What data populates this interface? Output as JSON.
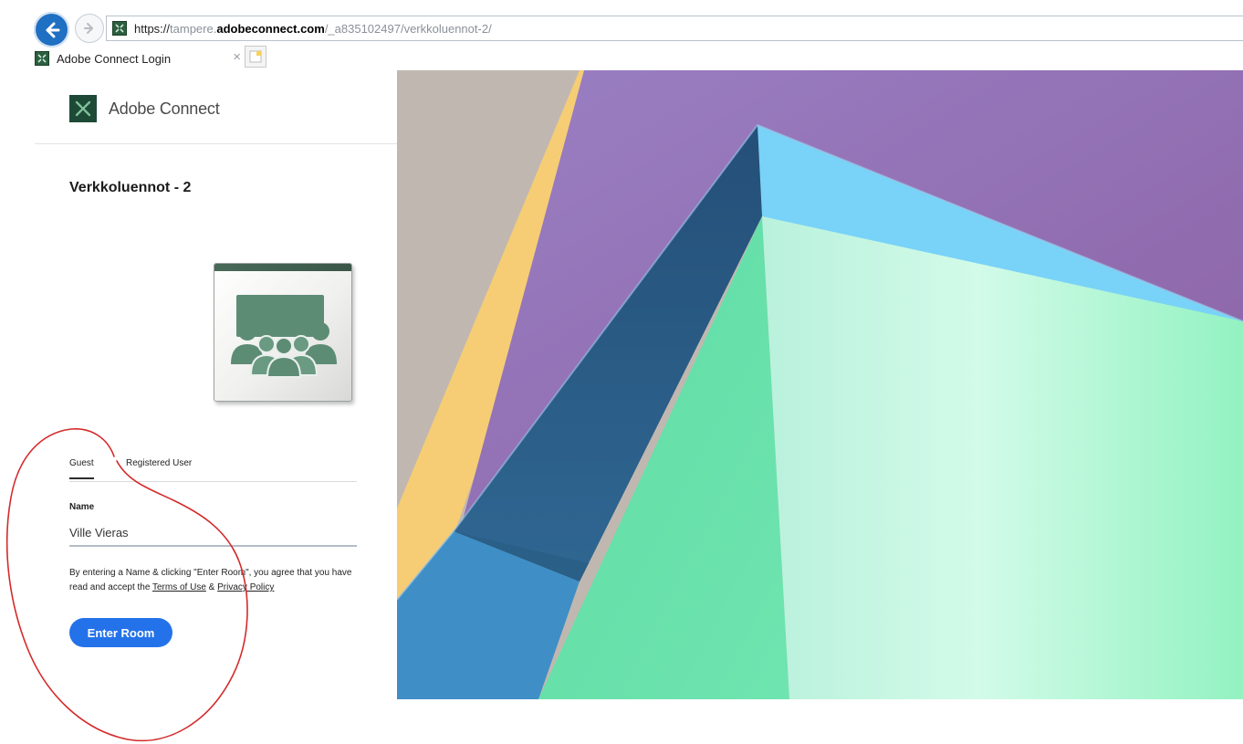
{
  "browser": {
    "url_protocol": "https://",
    "url_subdomain": "tampere.",
    "url_domain": "adobeconnect.com",
    "url_path": "/_a835102497/verkkoluennot-2/",
    "tab_title": "Adobe Connect Login",
    "tab_close": "×"
  },
  "brand": {
    "name": "Adobe Connect"
  },
  "room": {
    "title": "Verkkoluennot - 2",
    "icon": "meeting-room-icon"
  },
  "login": {
    "tabs": [
      {
        "label": "Guest",
        "active": true
      },
      {
        "label": "Registered User",
        "active": false
      }
    ],
    "name_label": "Name",
    "name_value": "Ville Vieras",
    "consent_prefix": "By entering a Name & clicking \"Enter Room\", you agree that you have read and accept the ",
    "terms_label": "Terms of Use",
    "consent_and": " & ",
    "privacy_label": "Privacy Policy",
    "enter_button": "Enter Room"
  },
  "colors": {
    "accent": "#2472ea",
    "browser_back": "#1f6fc2",
    "annotation": "#d42a2a"
  }
}
